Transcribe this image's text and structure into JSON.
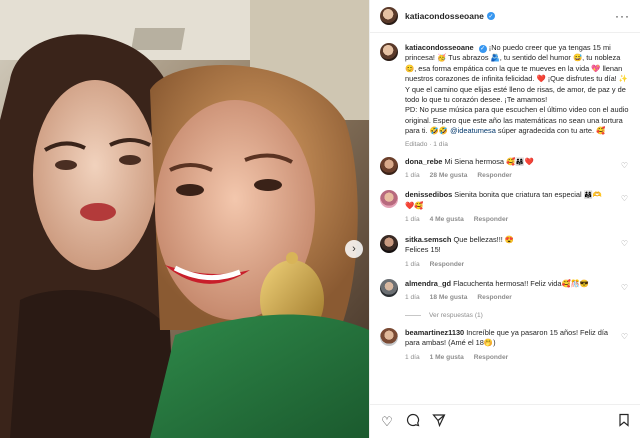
{
  "post": {
    "username": "katiacondosseoane",
    "more_icon": "more-horizontal-icon"
  },
  "caption": {
    "username": "katiacondosseoane",
    "p1": "¡No puedo creer que ya tengas 15 mi princesa! 🥳 Tus abrazos 🫂, tu sentido del humor 😅, tu nobleza 😊, esa forma empática con la que te mueves en la vida 💖 llenan nuestros corazones de infinita felicidad. ❤️ ¡Que disfrutes tu día! ✨ Y que el camino que elijas esté lleno de risas, de amor, de paz y de todo lo que tu corazón desee. ¡Te amamos!",
    "p2_a": "PD: No puse música para que escuchen el último video con el audio original. Espero que este año las matemáticas no sean una tortura para ti. 🤣🤣",
    "p2_mention": "@ideatumesa",
    "p2_b": " súper agradecida con tu arte. 🥰",
    "edited": "Editado · 1 día"
  },
  "comments": [
    {
      "username": "dona_rebe",
      "text": "Mi Siena hermosa 🥰👨‍👩‍👧❤️",
      "time": "1 día",
      "likes": "28 Me gusta",
      "reply": "Responder"
    },
    {
      "username": "denissedibos",
      "text": "Sienita bonita que criatura tan especial 👨‍👩‍👧🫶",
      "extra": "❤️🥰",
      "time": "1 día",
      "likes": "4 Me gusta",
      "reply": "Responder"
    },
    {
      "username": "sitka.semsch",
      "text": "Que bellezas!!! 😍",
      "extra": "Felices 15!",
      "time": "1 día",
      "likes": "",
      "reply": "Responder"
    },
    {
      "username": "almendra_gd",
      "text": "Flacuchenta hermosa!! Feliz vida🥰🎊😎",
      "time": "1 día",
      "likes": "18 Me gusta",
      "reply": "Responder"
    },
    {
      "username": "beamartinez1130",
      "text": "Increíble que ya pasaron 15 años! Feliz día para ambas! (Amé el 18🤭)",
      "time": "1 día",
      "likes": "1 Me gusta",
      "reply": "Responder"
    }
  ],
  "replies_label": "Ver respuestas (1)",
  "icons": {
    "like": "heart-icon",
    "comment": "comment-icon",
    "share": "share-icon",
    "save": "bookmark-icon",
    "next": "chevron-right-icon",
    "verified": "verified-badge-icon"
  },
  "colors": {
    "verified": "#3897f0",
    "muted_text": "#8e8e8e",
    "mention": "#00376b"
  }
}
